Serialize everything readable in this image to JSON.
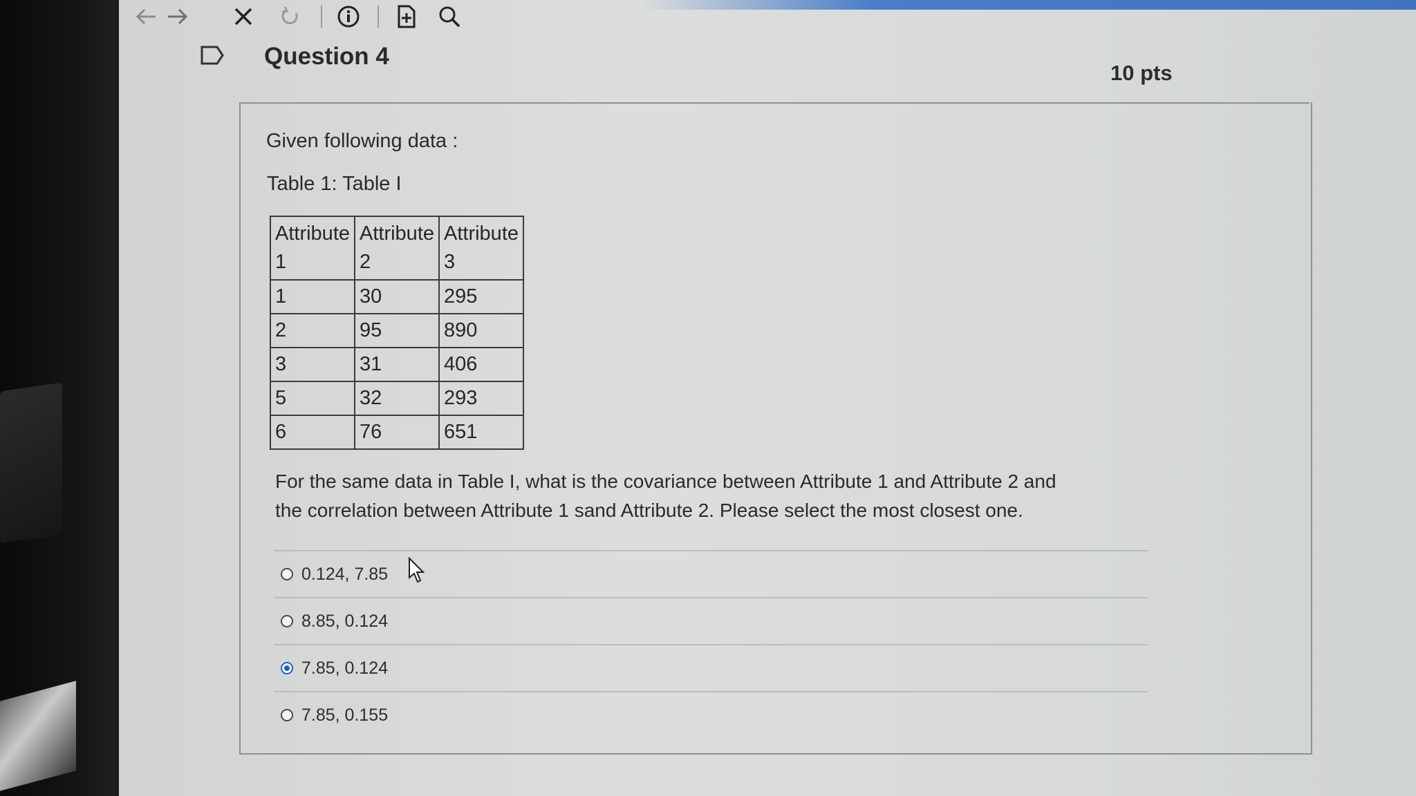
{
  "toolbar": {
    "back_icon": "arrow-left-icon",
    "forward_icon": "arrow-right-icon",
    "close_icon": "close-icon",
    "reload_icon": "reload-icon",
    "info_icon": "info-icon",
    "add_page_icon": "add-page-icon",
    "search_icon": "search-icon"
  },
  "question": {
    "title": "Question 4",
    "points": "10 pts",
    "intro": "Given following data :",
    "table_caption": "Table 1: Table I",
    "table": {
      "headers": [
        [
          "Attribute",
          "1"
        ],
        [
          "Attribute",
          "2"
        ],
        [
          "Attribute",
          "3"
        ]
      ],
      "rows": [
        [
          "1",
          "30",
          "295"
        ],
        [
          "2",
          "95",
          "890"
        ],
        [
          "3",
          "31",
          "406"
        ],
        [
          "5",
          "32",
          "293"
        ],
        [
          "6",
          "76",
          "651"
        ]
      ]
    },
    "prompt": "For the same data in Table I, what is the covariance between Attribute 1 and Attribute 2 and the correlation between Attribute 1 sand Attribute 2. Please select the most closest one.",
    "answers": [
      {
        "label": "0.124, 7.85",
        "selected": false
      },
      {
        "label": "8.85, 0.124",
        "selected": false
      },
      {
        "label": "7.85, 0.124",
        "selected": true
      },
      {
        "label": "7.85, 0.155",
        "selected": false
      }
    ]
  },
  "colors": {
    "accent": "#1a5fd1",
    "text": "#2a2a2a",
    "border": "#8e8e8e"
  }
}
